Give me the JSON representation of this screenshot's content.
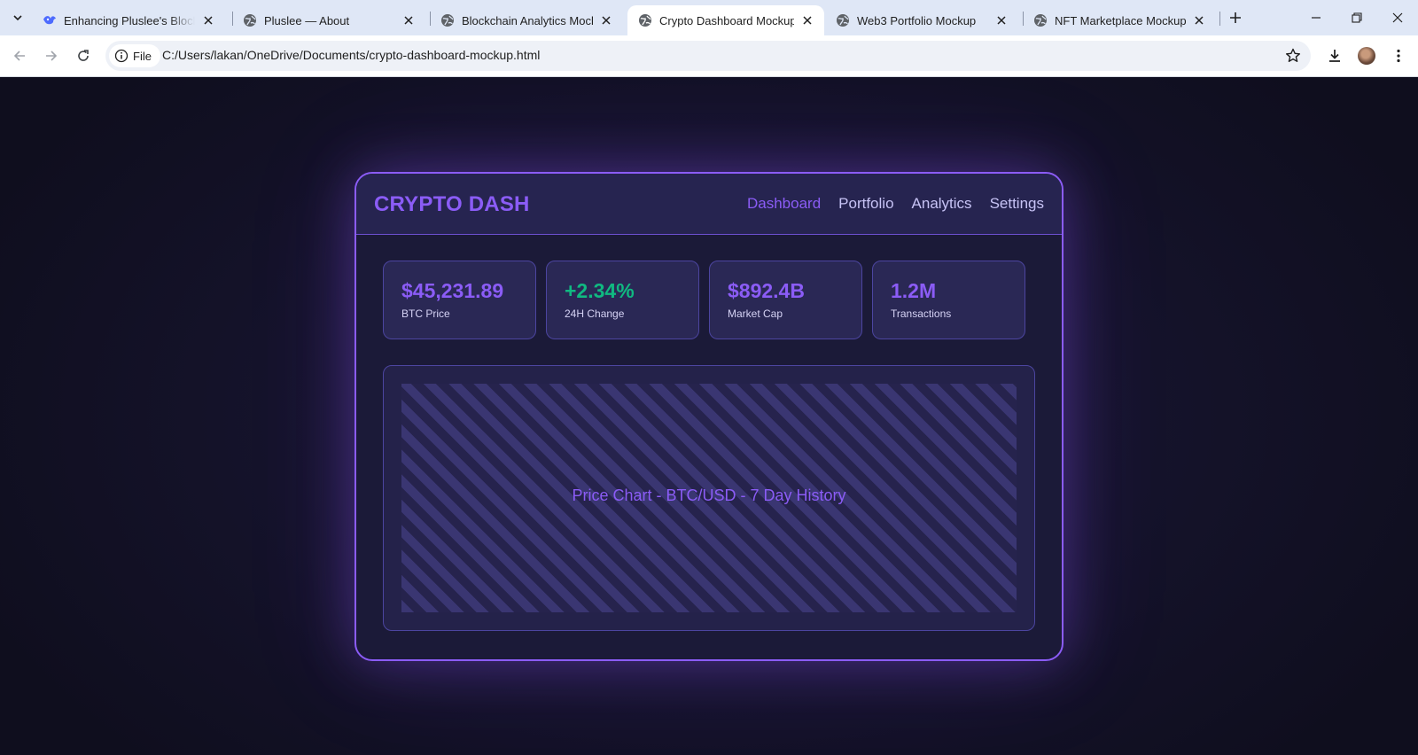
{
  "browser": {
    "tabs": [
      {
        "title": "Enhancing Pluslee's Blockcha",
        "favicon": "pluslee-logo-icon",
        "active": false
      },
      {
        "title": "Pluslee — About",
        "favicon": "globe-icon",
        "active": false
      },
      {
        "title": "Blockchain Analytics Mockup",
        "favicon": "globe-icon",
        "active": false
      },
      {
        "title": "Crypto Dashboard Mockup",
        "favicon": "globe-icon",
        "active": true
      },
      {
        "title": "Web3 Portfolio Mockup",
        "favicon": "globe-icon",
        "active": false
      },
      {
        "title": "NFT Marketplace Mockup",
        "favicon": "globe-icon",
        "active": false
      }
    ],
    "address": {
      "chip_label": "File",
      "url": "C:/Users/lakan/OneDrive/Documents/crypto-dashboard-mockup.html"
    },
    "colors": {
      "tabstrip": "#dfe7f6",
      "toolbar": "#ffffff",
      "omnibox": "#eef1f7"
    }
  },
  "dashboard": {
    "brand": "CRYPTO DASH",
    "nav": [
      {
        "label": "Dashboard",
        "active": true
      },
      {
        "label": "Portfolio",
        "active": false
      },
      {
        "label": "Analytics",
        "active": false
      },
      {
        "label": "Settings",
        "active": false
      }
    ],
    "stats": [
      {
        "value": "$45,231.89",
        "label": "BTC Price"
      },
      {
        "value": "+2.34%",
        "label": "24H Change"
      },
      {
        "value": "$892.4B",
        "label": "Market Cap"
      },
      {
        "value": "1.2M",
        "label": "Transactions"
      }
    ],
    "chart_placeholder": "Price Chart - BTC/USD - 7 Day History",
    "colors": {
      "accent": "#8b5cf6",
      "positive": "#10b981",
      "panel": "#1b1a38",
      "card": "#2a2855"
    }
  }
}
